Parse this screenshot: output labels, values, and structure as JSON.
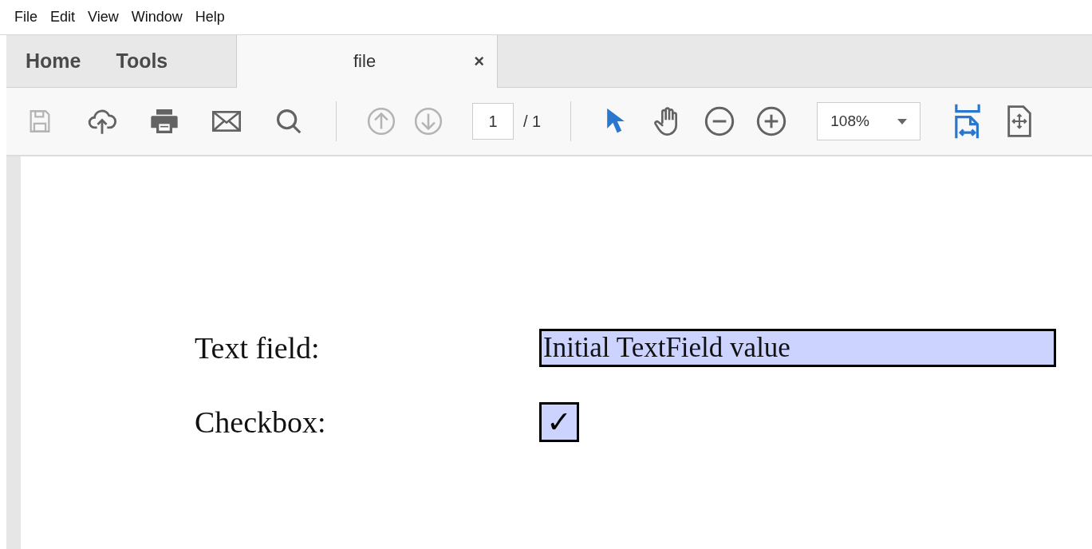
{
  "menu": [
    "File",
    "Edit",
    "View",
    "Window",
    "Help"
  ],
  "tabs": [
    {
      "label": "Home",
      "selected": false
    },
    {
      "label": "Tools",
      "selected": false
    }
  ],
  "document_tab": {
    "title": "file",
    "close": "×",
    "selected": true
  },
  "toolbar": {
    "file_tools": [
      {
        "kind": "save",
        "disabled": true
      },
      {
        "kind": "upload",
        "disabled": false
      },
      {
        "kind": "print",
        "disabled": false
      },
      {
        "kind": "email",
        "disabled": false
      },
      {
        "kind": "search",
        "disabled": false
      }
    ],
    "page_tools": [
      {
        "kind": "page-up",
        "disabled": true
      },
      {
        "kind": "page-down",
        "disabled": true
      }
    ],
    "page_number": "1",
    "page_total": "/ 1",
    "view_tools": [
      {
        "kind": "select",
        "selected": true
      },
      {
        "kind": "hand",
        "selected": false
      },
      {
        "kind": "zoom-out",
        "selected": false
      },
      {
        "kind": "zoom-in",
        "selected": false
      }
    ],
    "zoom": "108%",
    "layout_tools": [
      {
        "kind": "fit-width",
        "selected": true
      },
      {
        "kind": "fit-page",
        "selected": false
      }
    ]
  },
  "form": [
    {
      "kind": "text",
      "label": "Text field:",
      "value": "Initial TextField value"
    },
    {
      "kind": "checkbox",
      "label": "Checkbox:",
      "checked": true,
      "mark": "✓"
    }
  ]
}
